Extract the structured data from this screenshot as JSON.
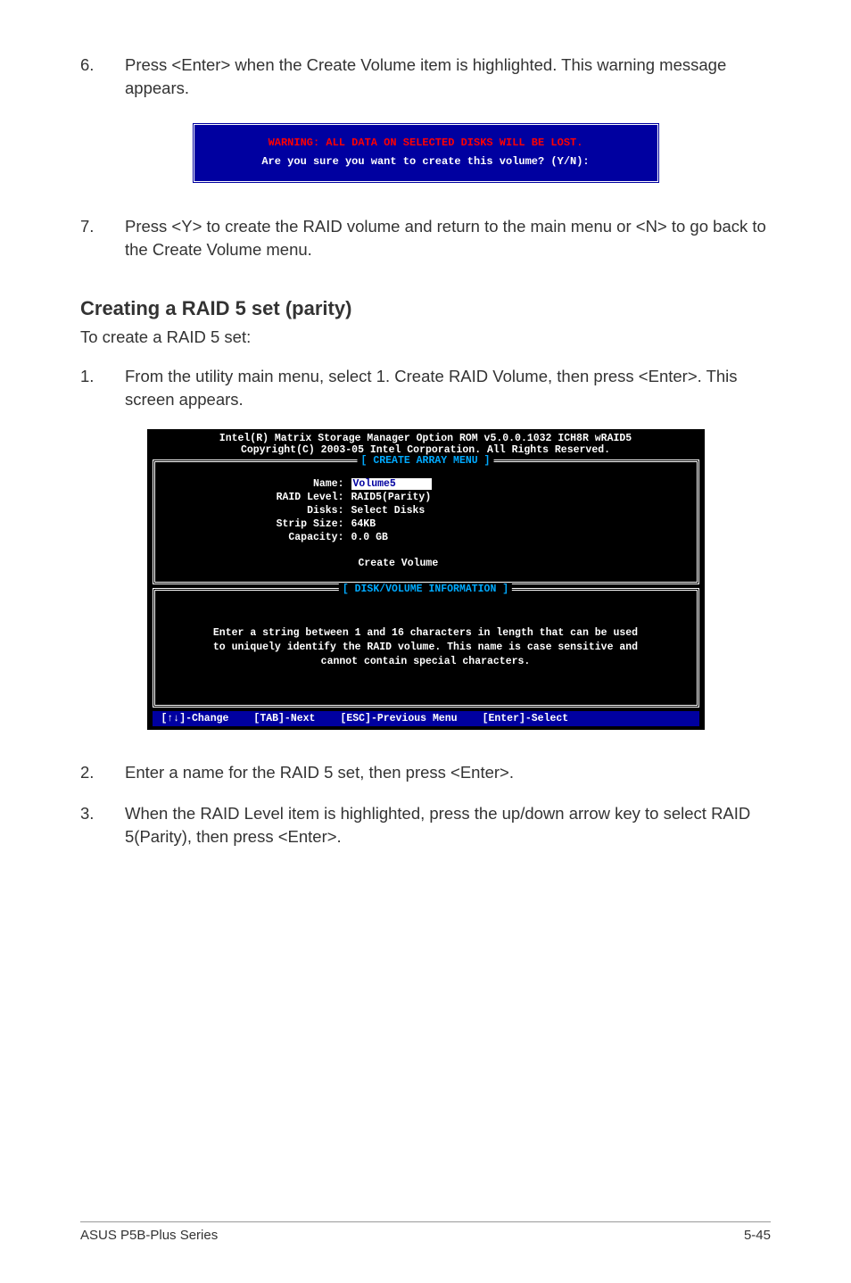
{
  "step6": {
    "num": "6.",
    "text": "Press <Enter> when the Create Volume item is highlighted. This warning message appears."
  },
  "warning_box": {
    "warn": "WARNING: ALL DATA ON SELECTED DISKS WILL BE LOST.",
    "prompt": "Are you sure you want to create this volume? (Y/N):"
  },
  "step7": {
    "num": "7.",
    "text": "Press <Y> to create the RAID volume and return to the main menu or <N> to go back to the Create Volume menu."
  },
  "heading": "Creating a RAID 5 set (parity)",
  "heading_sub": "To create a RAID 5 set:",
  "step1": {
    "num": "1.",
    "text": "From the utility main menu, select 1. Create RAID Volume, then press <Enter>. This screen appears."
  },
  "bios": {
    "header1": "Intel(R) Matrix Storage Manager Option ROM v5.0.0.1032 ICH8R wRAID5",
    "header2": "Copyright(C) 2003-05 Intel Corporation. All Rights Reserved.",
    "panel1_title": "[ CREATE ARRAY MENU ]",
    "form": {
      "name_label": "Name:",
      "name_value": "Volume5",
      "raid_label": "RAID Level:",
      "raid_value": "RAID5(Parity)",
      "disks_label": "Disks:",
      "disks_value": "Select Disks",
      "strip_label": "Strip Size:",
      "strip_value": "64KB",
      "capacity_label": "Capacity:",
      "capacity_value": "0.0  GB"
    },
    "create_volume": "Create Volume",
    "panel2_title": "[ DISK/VOLUME INFORMATION ]",
    "info1": "Enter a string between 1 and 16 characters in length that can be used",
    "info2": "to uniquely identify the RAID volume. This name is case sensitive and",
    "info3": "cannot contain special characters.",
    "footer": {
      "change": "[↑↓]-Change",
      "next": "[TAB]-Next",
      "prev": "[ESC]-Previous Menu",
      "select": "[Enter]-Select"
    }
  },
  "step2": {
    "num": "2.",
    "text": "Enter a name for the RAID 5 set, then press <Enter>."
  },
  "step3": {
    "num": "3.",
    "text": "When the RAID Level item is highlighted, press the up/down arrow key to select RAID 5(Parity), then press <Enter>."
  },
  "footer": {
    "left": "ASUS P5B-Plus Series",
    "right": "5-45"
  }
}
